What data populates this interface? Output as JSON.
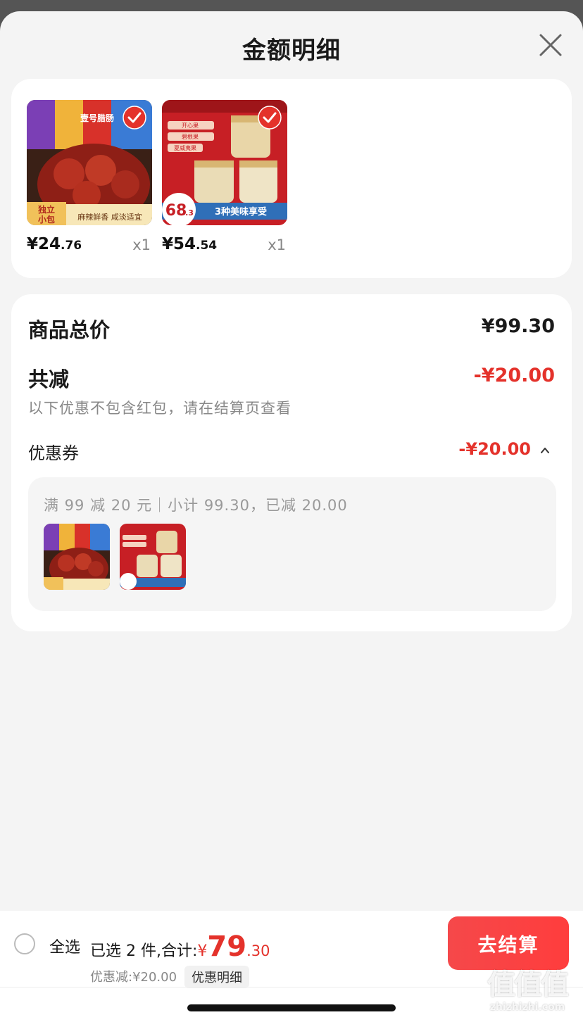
{
  "header": {
    "title": "金额明细"
  },
  "products": [
    {
      "price_int": "¥24",
      "price_dec": ".76",
      "qty": "x1",
      "thumb_labels": [
        "独立",
        "小包",
        "麻辣鲜香 咸淡适宜",
        "壹号腊肠"
      ]
    },
    {
      "price_int": "¥54",
      "price_dec": ".54",
      "qty": "x1",
      "thumb_labels": [
        "68",
        ".3",
        "3种美味享受",
        "开心果",
        "碧根果",
        "夏威夷果"
      ]
    }
  ],
  "summary": {
    "total_label": "商品总价",
    "total_value": "¥99.30",
    "reduce_label": "共减",
    "reduce_value": "-¥20.00",
    "note": "以下优惠不包含红包，请在结算页查看",
    "coupon_label": "优惠券",
    "coupon_value": "-¥20.00",
    "coupon_desc": "满 99 减 20 元｜小计 99.30，已减 20.00"
  },
  "bottom": {
    "select_all": "全选",
    "selected_text": "已选 2 件,合计:",
    "total_yen": "¥",
    "total_int": "79",
    "total_dec": ".30",
    "discount_line": "优惠减:¥20.00",
    "detail_label": "优惠明细",
    "checkout_label": "去结算"
  },
  "watermark": {
    "main": "值值值",
    "sub": "zhizhizhi.com"
  },
  "colors": {
    "accent": "#e4322b",
    "button": "#f5484a",
    "background": "#f4f4f4"
  }
}
